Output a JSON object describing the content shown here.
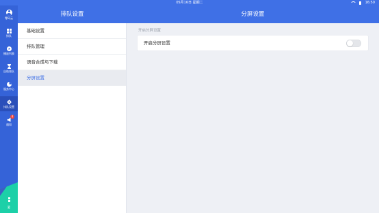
{
  "status_bar": {
    "date": "05月16日 星期二",
    "time": "16:50"
  },
  "rail": {
    "items": [
      {
        "label": "零码云",
        "icon": "avatar-icon"
      },
      {
        "label": "排队",
        "icon": "grid-icon"
      },
      {
        "label": "播放列表",
        "icon": "play-icon"
      },
      {
        "label": "自助排队",
        "icon": "hourglass-icon"
      },
      {
        "label": "服务中心",
        "icon": "pie-chart-icon"
      },
      {
        "label": "排队设置",
        "icon": "gear-icon"
      },
      {
        "label": "通知",
        "icon": "megaphone-icon",
        "badge": "4"
      }
    ],
    "bottom": {
      "label": "更",
      "icon": "more-icon"
    }
  },
  "left_header": {
    "title": "排队设置"
  },
  "menu": {
    "items": [
      {
        "label": "基础设置"
      },
      {
        "label": "排队管理"
      },
      {
        "label": "语音合成与下载"
      },
      {
        "label": "分屏设置"
      }
    ],
    "active_index": 3
  },
  "right_header": {
    "title": "分屏设置"
  },
  "content": {
    "section_title": "开启分屏设置",
    "setting": {
      "label": "开启分屏设置",
      "enabled": false
    }
  },
  "colors": {
    "primary": "#3f70e6",
    "rail": "#3563d8",
    "teal": "#1dd0a8",
    "badge": "#f0443a"
  }
}
